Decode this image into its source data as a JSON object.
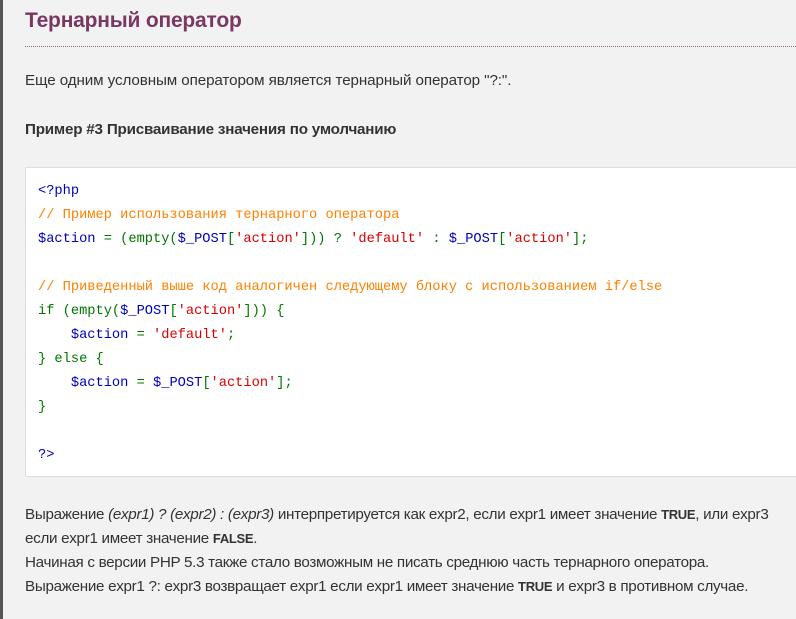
{
  "heading": "Тернарный оператор",
  "intro": "Еще одним условным оператором является тернарный оператор \"?:\".",
  "example_title": "Пример #3 Присваивание значения по умолчанию",
  "code": {
    "open_tag": "<?php",
    "comment1": "// Пример использования тернарного оператора",
    "var_action": "$action",
    "eq": " = (empty(",
    "post": "$_POST",
    "lb": "[",
    "str_action": "'action'",
    "rb_close": "])) ? ",
    "str_default": "'default'",
    "colon": " : ",
    "end": "];",
    "comment2": "// Приведенный выше код аналогичен следующему блоку с использованием if/else",
    "if_start": "if (empty(",
    "if_end": "])) {",
    "indent_eq": " = ",
    "semicolon": ";",
    "else": "} else {",
    "close_brace": "}",
    "close_tag": "?>"
  },
  "description": {
    "l1_a": "Выражение ",
    "expr1": "(expr1)",
    "q": " ? ",
    "expr2": "(expr2)",
    "c": " : ",
    "expr3": "(expr3)",
    "l1_b": " интерпретируется как expr2, если expr1 имеет значение ",
    "true": "TRUE",
    "l1_c": ", или expr3 если expr1 имеет",
    "l2_a": "значение ",
    "false": "FALSE",
    "l2_b": ".",
    "l3": "Начиная с версии PHP 5.3 также стало возможным не писать среднюю часть тернарного оператора. Выражение expr1 ?: expr3",
    "l4_a": "возвращает expr1 если expr1 имеет значение ",
    "l4_b": " и expr3 в противном случае."
  }
}
